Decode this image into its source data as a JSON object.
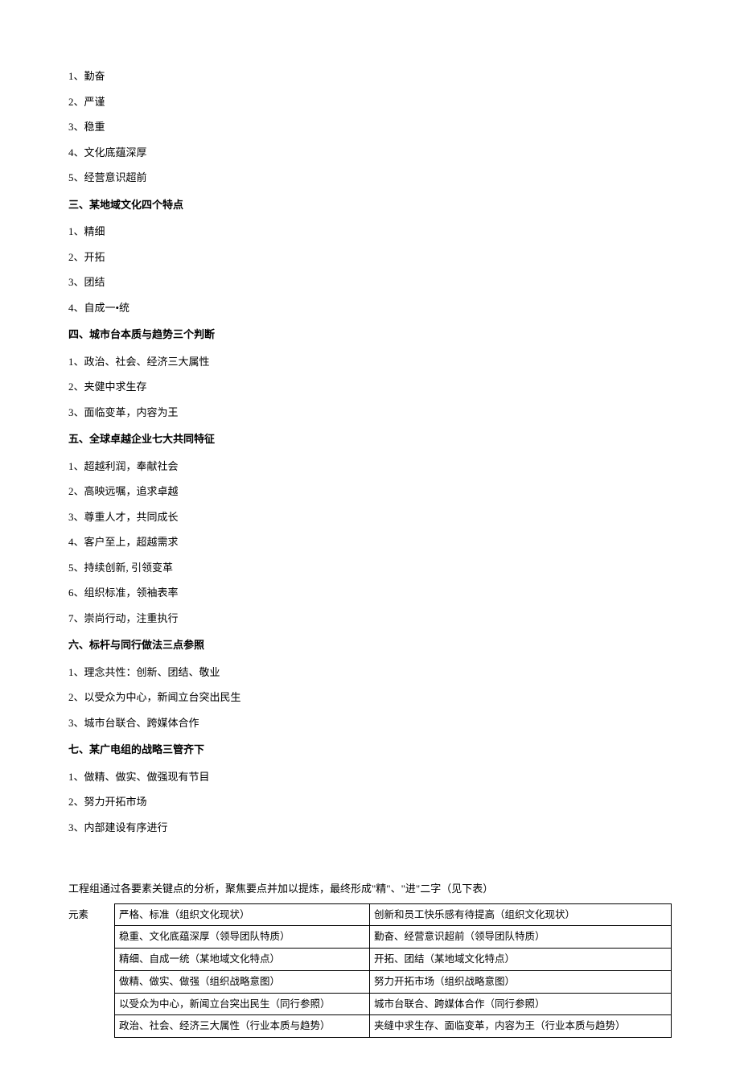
{
  "section_a": {
    "items": [
      "1、勤奋",
      "2、严谨",
      "3、稳重",
      "4、文化底蕴深厚",
      "5、经营意识超前"
    ]
  },
  "section_b": {
    "heading": "三、某地域文化四个特点",
    "items": [
      "1、精细",
      "2、开拓",
      "3、团结",
      "4、自成一•统"
    ]
  },
  "section_c": {
    "heading": "四、城市台本质与趋势三个判断",
    "items": [
      "1、政治、社会、经济三大属性",
      "2、夹健中求生存",
      "3、面临变革，内容为王"
    ]
  },
  "section_d": {
    "heading": "五、全球卓越企业七大共同特征",
    "items": [
      "1、超越利润，奉献社会",
      "2、高映远嘱，追求卓越",
      "3、尊重人才，共同成长",
      "4、客户至上，超越需求",
      "5、持续创新, 引领变革",
      "6、组织标准，领袖表率",
      "7、崇尚行动，注重执行"
    ]
  },
  "section_e": {
    "heading": "六、标杆与同行做法三点参照",
    "items": [
      "1、理念共性：创新、团结、敬业",
      "2、以受众为中心，新闻立台突出民生",
      "3、城市台联合、跨媒体合作"
    ]
  },
  "section_f": {
    "heading": "七、某广电组的战略三管齐下",
    "items": [
      "1、做精、做实、做强现有节目",
      "2、努力开拓市场",
      "3、内部建设有序进行"
    ]
  },
  "table": {
    "intro": "工程组通过各要素关键点的分析，聚焦要点并加以提炼，最终形成\"精\"、\"进\"二字（见下表）",
    "label": "元素",
    "rows": [
      {
        "left": "严格、标准（组织文化现状）",
        "right": "创新和员工快乐感有待提高（组织文化现状）"
      },
      {
        "left": "稳重、文化底蕴深厚（领导团队特质）",
        "right": "勤奋、经营意识超前（领导团队特质）"
      },
      {
        "left": "精细、自成一统（某地域文化特点）",
        "right": "开拓、团结（某地域文化特点）"
      },
      {
        "left": "做精、做实、做强（组织战略意图）",
        "right": "努力开拓市场（组织战略意图）"
      },
      {
        "left": "以受众为中心，新闻立台突出民生（同行参照）",
        "right": "城市台联合、跨媒体合作（同行参照）"
      },
      {
        "left": "政治、社会、经济三大属性（行业本质与趋势）",
        "right": "夹缝中求生存、面临变革，内容为王（行业本质与趋势）"
      }
    ]
  }
}
